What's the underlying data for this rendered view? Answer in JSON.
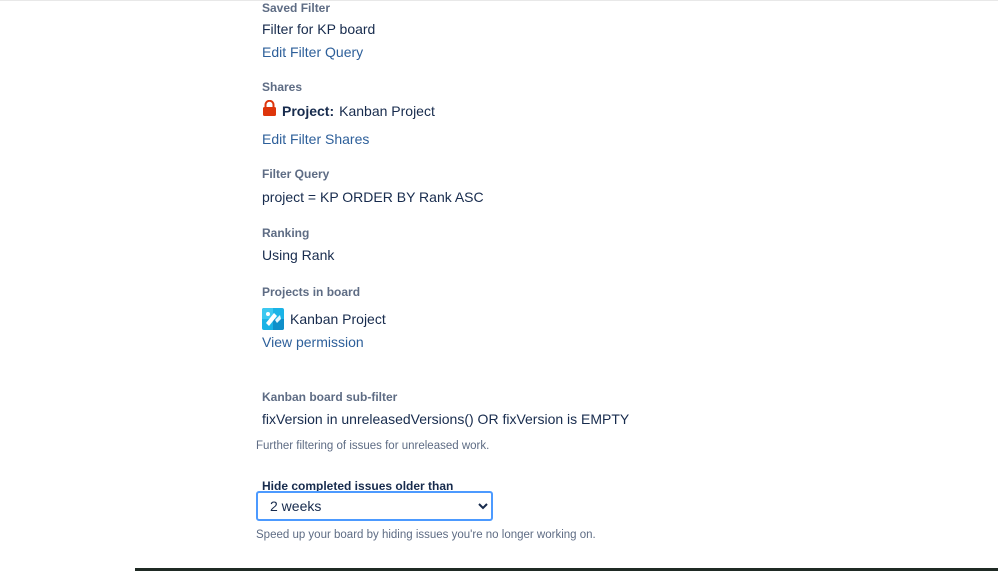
{
  "saved_filter": {
    "label": "Saved Filter",
    "value": "Filter for KP board",
    "edit_link": "Edit Filter Query"
  },
  "shares": {
    "label": "Shares",
    "lock_icon": "lock-icon",
    "type": "Project:",
    "project": "Kanban Project",
    "edit_link": "Edit Filter Shares"
  },
  "filter_query": {
    "label": "Filter Query",
    "value": "project = KP ORDER BY Rank ASC"
  },
  "ranking": {
    "label": "Ranking",
    "value": "Using Rank"
  },
  "projects_in_board": {
    "label": "Projects in board",
    "project_name": "Kanban Project",
    "avatar_icon": "project-avatar-icon",
    "permission_link": "View permission"
  },
  "subfilter": {
    "label": "Kanban board sub-filter",
    "value": "fixVersion in unreleasedVersions() OR fixVersion is EMPTY",
    "help": "Further filtering of issues for unreleased work."
  },
  "hide_completed": {
    "label": "Hide completed issues older than",
    "selected": "2 weeks",
    "help": "Speed up your board by hiding issues you're no longer working on."
  },
  "colors": {
    "link": "#2d5f9a",
    "focus_border": "#4c9aff",
    "lock": "#de350b",
    "text": "#172b4d",
    "muted": "#5e6c84"
  }
}
